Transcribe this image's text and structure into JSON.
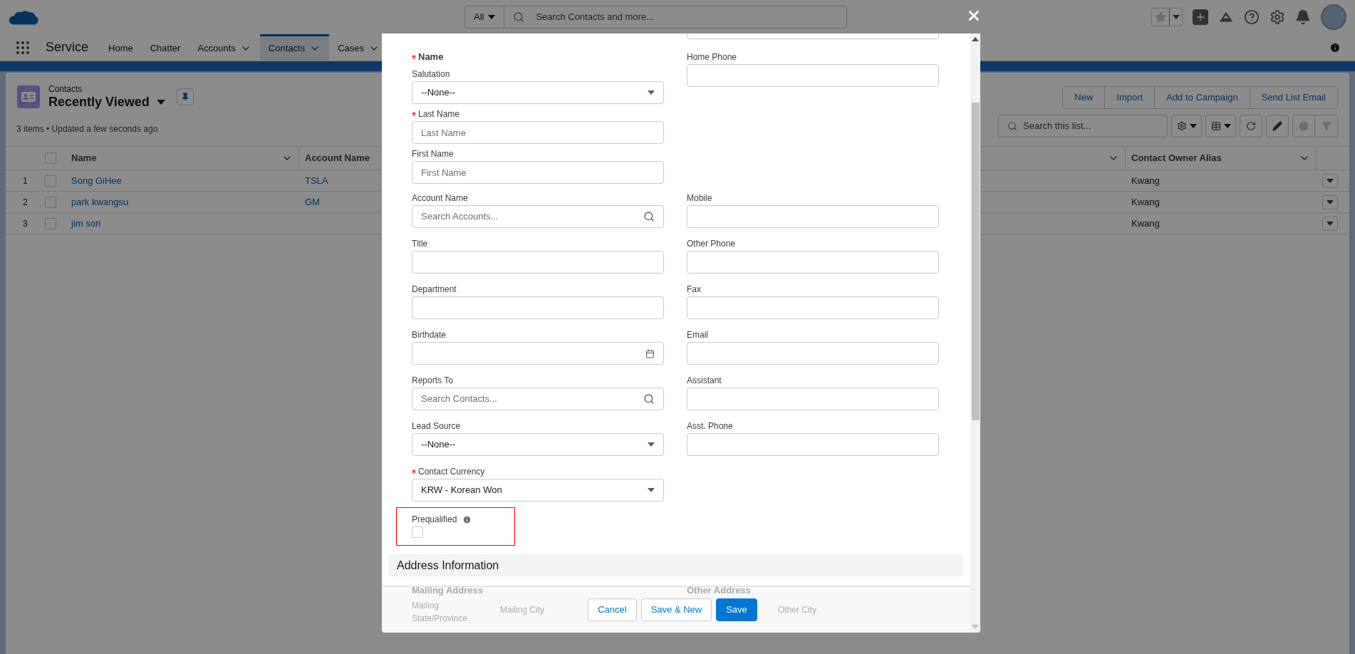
{
  "global_header": {
    "search_scope": "All",
    "search_placeholder": "Search Contacts and more..."
  },
  "nav": {
    "app_name": "Service",
    "tabs": [
      {
        "label": "Home",
        "has_menu": false,
        "selected": false
      },
      {
        "label": "Chatter",
        "has_menu": false,
        "selected": false
      },
      {
        "label": "Accounts",
        "has_menu": true,
        "selected": false
      },
      {
        "label": "Contacts",
        "has_menu": true,
        "selected": true
      },
      {
        "label": "Cases",
        "has_menu": true,
        "selected": false
      }
    ]
  },
  "list_view": {
    "object": "Contacts",
    "title": "Recently Viewed",
    "status": "3 items • Updated a few seconds ago",
    "actions": [
      "New",
      "Import",
      "Add to Campaign",
      "Send List Email"
    ],
    "search_placeholder": "Search this list...",
    "select_all_checked": false,
    "columns": [
      "Name",
      "Account Name",
      "Contact Owner Alias"
    ],
    "rows": [
      {
        "number": "1",
        "checked": false,
        "name": "Song GiHee",
        "account": "TSLA",
        "owner": "Kwang"
      },
      {
        "number": "2",
        "checked": false,
        "name": "park kwangsu",
        "account": "GM",
        "owner": "Kwang"
      },
      {
        "number": "3",
        "checked": false,
        "name": "jim sori",
        "owner": "Kwang"
      }
    ]
  },
  "modal": {
    "rows": [
      {
        "right": {
          "kind": "text"
        }
      },
      {
        "left": {
          "kind": "group",
          "label": "Name",
          "required": true,
          "parts": [
            {
              "kind": "select",
              "label": "Salutation",
              "required": false,
              "value": "--None--"
            },
            {
              "kind": "text",
              "label": "Last Name",
              "required": true,
              "placeholder": "Last Name"
            },
            {
              "kind": "text",
              "label": "First Name",
              "required": false,
              "placeholder": "First Name"
            }
          ]
        },
        "right": {
          "kind": "text",
          "label": "Home Phone",
          "required": false
        }
      },
      {
        "left": {
          "kind": "lookup",
          "label": "Account Name",
          "required": false,
          "placeholder": "Search Accounts..."
        },
        "right": {
          "kind": "text",
          "label": "Mobile",
          "required": false
        }
      },
      {
        "left": {
          "kind": "text",
          "label": "Title",
          "required": false
        },
        "right": {
          "kind": "text",
          "label": "Other Phone",
          "required": false
        }
      },
      {
        "left": {
          "kind": "text",
          "label": "Department",
          "required": false
        },
        "right": {
          "kind": "text",
          "label": "Fax",
          "required": false
        }
      },
      {
        "left": {
          "kind": "date",
          "label": "Birthdate",
          "required": false
        },
        "right": {
          "kind": "text",
          "label": "Email",
          "required": false
        }
      },
      {
        "left": {
          "kind": "lookup",
          "label": "Reports To",
          "required": false,
          "placeholder": "Search Contacts..."
        },
        "right": {
          "kind": "text",
          "label": "Assistant",
          "required": false
        }
      },
      {
        "left": {
          "kind": "select",
          "label": "Lead Source",
          "required": false,
          "value": "--None--"
        },
        "right": {
          "kind": "text",
          "label": "Asst. Phone",
          "required": false
        }
      },
      {
        "left": {
          "kind": "select",
          "label": "Contact Currency",
          "required": true,
          "value": "KRW - Korean Won"
        }
      },
      {
        "left": {
          "kind": "checkbox",
          "label": "Prequalified",
          "required": false,
          "checked": false,
          "highlighted": true
        }
      }
    ],
    "section": "Address Information",
    "address": {
      "left_heading": "Mailing Address",
      "left_label": "Mailing State/Province",
      "left_label_2": "Mailing City",
      "right_heading": "Other Address",
      "right_label": "Other City"
    },
    "buttons": [
      {
        "label": "Cancel",
        "kind": "neutral"
      },
      {
        "label": "Save & New",
        "kind": "neutral"
      },
      {
        "label": "Save",
        "kind": "brand"
      }
    ]
  }
}
